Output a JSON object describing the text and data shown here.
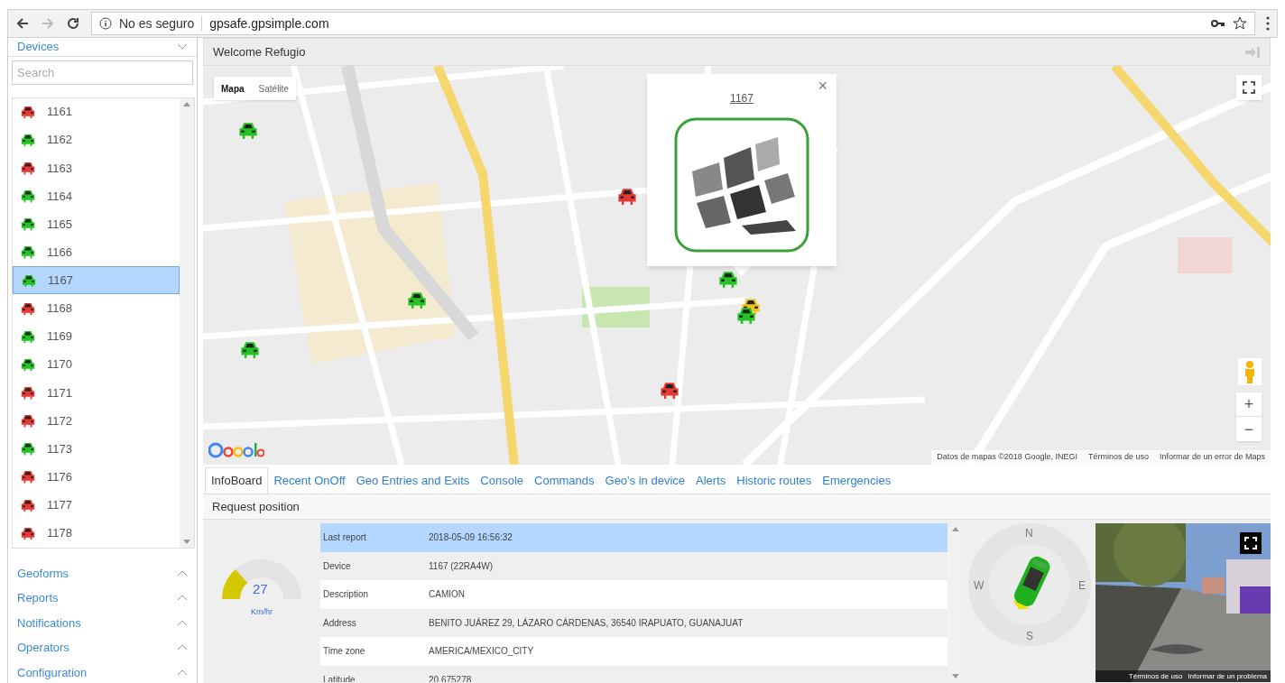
{
  "browser": {
    "security": "No es seguro",
    "url": "gpsafe.gpsimple.com"
  },
  "sidebar": {
    "devices_title": "Devices",
    "search_placeholder": "Search",
    "devices": [
      {
        "label": "1161",
        "color": "#e53935",
        "selected": false
      },
      {
        "label": "1162",
        "color": "#22c322",
        "selected": false
      },
      {
        "label": "1163",
        "color": "#e53935",
        "selected": false
      },
      {
        "label": "1164",
        "color": "#22c322",
        "selected": false
      },
      {
        "label": "1165",
        "color": "#22c322",
        "selected": false
      },
      {
        "label": "1166",
        "color": "#22c322",
        "selected": false
      },
      {
        "label": "1167",
        "color": "#22c322",
        "selected": true
      },
      {
        "label": "1168",
        "color": "#e53935",
        "selected": false
      },
      {
        "label": "1169",
        "color": "#22c322",
        "selected": false
      },
      {
        "label": "1170",
        "color": "#22c322",
        "selected": false
      },
      {
        "label": "1171",
        "color": "#e53935",
        "selected": false
      },
      {
        "label": "1172",
        "color": "#e53935",
        "selected": false
      },
      {
        "label": "1173",
        "color": "#22c322",
        "selected": false
      },
      {
        "label": "1176",
        "color": "#e53935",
        "selected": false
      },
      {
        "label": "1177",
        "color": "#e53935",
        "selected": false
      },
      {
        "label": "1178",
        "color": "#e53935",
        "selected": false
      }
    ],
    "sections": [
      "Geoforms",
      "Reports",
      "Notifications",
      "Operators",
      "Configuration"
    ]
  },
  "header": {
    "welcome": "Welcome Refugio"
  },
  "map": {
    "map_types": [
      {
        "label": "Mapa",
        "selected": true
      },
      {
        "label": "Satélite",
        "selected": false
      }
    ],
    "markers": [
      {
        "color": "#22c322"
      },
      {
        "color": "#e53935"
      },
      {
        "color": "#22c322"
      },
      {
        "color": "#22c322"
      },
      {
        "color": "#22c322"
      },
      {
        "color": "#f2c418"
      },
      {
        "color": "#22c322"
      },
      {
        "color": "#e53935"
      }
    ],
    "popup": {
      "title": "1167",
      "close": "×"
    },
    "zoom_in": "+",
    "zoom_out": "−",
    "attribution": [
      "Datos de mapas ©2018 Google, INEGI",
      "Términos de uso",
      "Informar de un error de Maps"
    ]
  },
  "tabs": [
    {
      "label": "InfoBoard",
      "selected": true
    },
    {
      "label": "Recent OnOff",
      "selected": false
    },
    {
      "label": "Geo Entries and Exits",
      "selected": false
    },
    {
      "label": "Console",
      "selected": false
    },
    {
      "label": "Commands",
      "selected": false
    },
    {
      "label": "Geo's in device",
      "selected": false
    },
    {
      "label": "Alerts",
      "selected": false
    },
    {
      "label": "Historic routes",
      "selected": false
    },
    {
      "label": "Emergencies",
      "selected": false
    }
  ],
  "request_position": "Request position",
  "gauge": {
    "value": "27",
    "unit": "Km/hr",
    "level": 0.27
  },
  "info_rows": [
    {
      "label": "Last report",
      "value": "2018-05-09 16:56:32",
      "selected": true
    },
    {
      "label": "Device",
      "value": "1167 (22RA4W)",
      "selected": false
    },
    {
      "label": "Description",
      "value": "CAMION",
      "selected": false
    },
    {
      "label": "Address",
      "value": "BENITO JUÁREZ 29, LÁZARO CÁRDENAS, 36540 IRAPUATO, GUANAJUAT",
      "selected": false
    },
    {
      "label": "Time zone",
      "value": "AMERICA/MEXICO_CITY",
      "selected": false
    },
    {
      "label": "Latitude",
      "value": "20.675278",
      "selected": false
    }
  ],
  "compass": [
    "N",
    "E",
    "S",
    "W"
  ],
  "street_view": {
    "links": [
      "Términos de uso",
      "Informar de un problema"
    ]
  }
}
